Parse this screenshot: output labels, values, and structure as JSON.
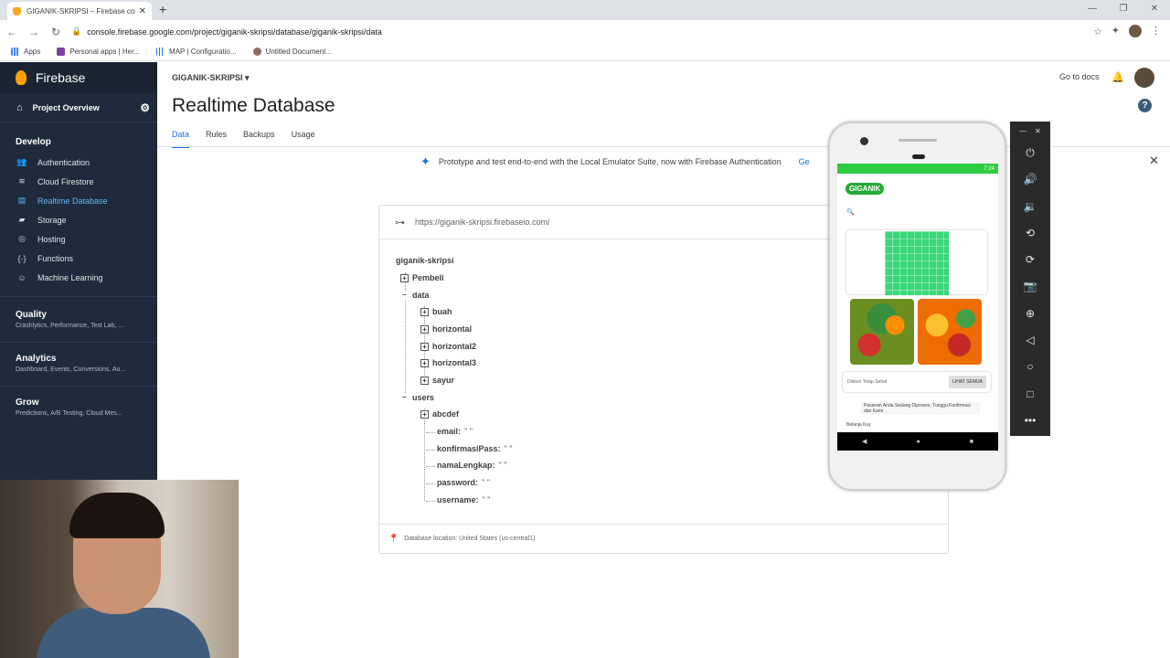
{
  "browser": {
    "tab_title": "GIGANIK-SKRIPSI – Firebase con",
    "url": "console.firebase.google.com/project/giganik-skripsi/database/giganik-skripsi/data",
    "bookmarks": [
      {
        "label": "Apps"
      },
      {
        "label": "Personal apps | Her..."
      },
      {
        "label": "MAP | Configuratio..."
      },
      {
        "label": "Untitled Document..."
      }
    ]
  },
  "sidebar": {
    "brand": "Firebase",
    "project_overview": "Project Overview",
    "develop_title": "Develop",
    "items": [
      {
        "label": "Authentication",
        "icon": "people-icon"
      },
      {
        "label": "Cloud Firestore",
        "icon": "firestore-icon"
      },
      {
        "label": "Realtime Database",
        "icon": "database-icon",
        "active": true
      },
      {
        "label": "Storage",
        "icon": "folder-icon"
      },
      {
        "label": "Hosting",
        "icon": "globe-icon"
      },
      {
        "label": "Functions",
        "icon": "functions-icon"
      },
      {
        "label": "Machine Learning",
        "icon": "robot-icon"
      }
    ],
    "groups": [
      {
        "title": "Quality",
        "subtitle": "Crashlytics, Performance, Test Lab, ..."
      },
      {
        "title": "Analytics",
        "subtitle": "Dashboard, Events, Conversions, Au..."
      },
      {
        "title": "Grow",
        "subtitle": "Predictions, A/B Testing, Cloud Mes..."
      }
    ]
  },
  "header": {
    "project_name": "GIGANIK-SKRIPSI",
    "go_to_docs": "Go to docs",
    "title": "Realtime Database",
    "tabs": [
      "Data",
      "Rules",
      "Backups",
      "Usage"
    ],
    "active_tab": "Data"
  },
  "banner": {
    "text": "Prototype and test end-to-end with the Local Emulator Suite, now with Firebase Authentication",
    "link": "Ge"
  },
  "database": {
    "url": "https://giganik-skripsi.firebaseio.com/",
    "root": "giganik-skripsi",
    "pembeli": "Pembeli",
    "data": "data",
    "data_children": [
      "buah",
      "horizontal",
      "horizontal2",
      "horizontal3",
      "sayur"
    ],
    "users": "users",
    "abcdef": "abcdef",
    "fields": [
      {
        "key": "email:",
        "value": "\" \""
      },
      {
        "key": "konfirmasiPass:",
        "value": "\" \""
      },
      {
        "key": "namaLengkap:",
        "value": "\" \""
      },
      {
        "key": "password:",
        "value": "\" \""
      },
      {
        "key": "username:",
        "value": "\" \""
      }
    ],
    "location": "Database location: United States (us-central1)"
  },
  "phone": {
    "time": "7:24",
    "app_logo": "GIGANIK",
    "promo_text": "Diskon Tetap Sehat",
    "promo_button": "LIHAT SEMUA",
    "toast": "Pesanan Anda Sedang Diproses, Tunggu Konfirmasi dari Kami",
    "footer_label": "Belanja Kuy"
  },
  "colors": {
    "sidebar_bg": "#1f2b3c",
    "accent": "#1a73e8",
    "app_green": "#2ecc40"
  }
}
